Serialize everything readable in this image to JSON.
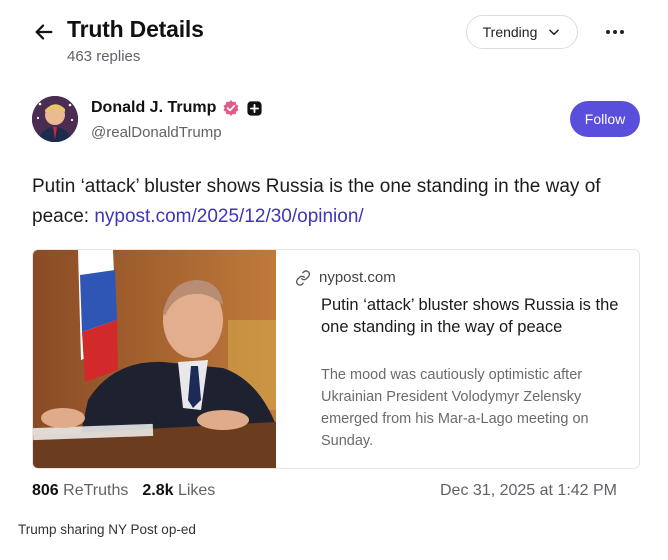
{
  "header": {
    "title": "Truth Details",
    "replies": "463 replies",
    "sort_label": "Trending",
    "back_icon": "arrow-left-icon",
    "more_icon": "more-horizontal-icon"
  },
  "author": {
    "name": "Donald J. Trump",
    "handle": "@realDonaldTrump",
    "verified_color": "#e25a8b",
    "follow_label": "Follow"
  },
  "post": {
    "text": "Putin ‘attack’ bluster shows Russia is the one standing in the way of peace: ",
    "link_text": "nypost.com/2025/12/30/opinion/"
  },
  "card": {
    "source": "nypost.com",
    "headline": "Putin ‘attack’ bluster shows Russia is the one standing in the way of peace",
    "description": "The mood was cautiously optimistic after Ukrainian President Volodymyr Zelensky emerged from his Mar-a-Lago meeting on Sunday."
  },
  "stats": {
    "retruths_count": "806",
    "retruths_label": "ReTruths",
    "likes_count": "2.8k",
    "likes_label": "Likes",
    "timestamp": "Dec 31, 2025 at 1:42 PM"
  },
  "caption": "Trump sharing NY Post op-ed",
  "colors": {
    "accent": "#5a4fdc",
    "link": "#3c36b8"
  }
}
